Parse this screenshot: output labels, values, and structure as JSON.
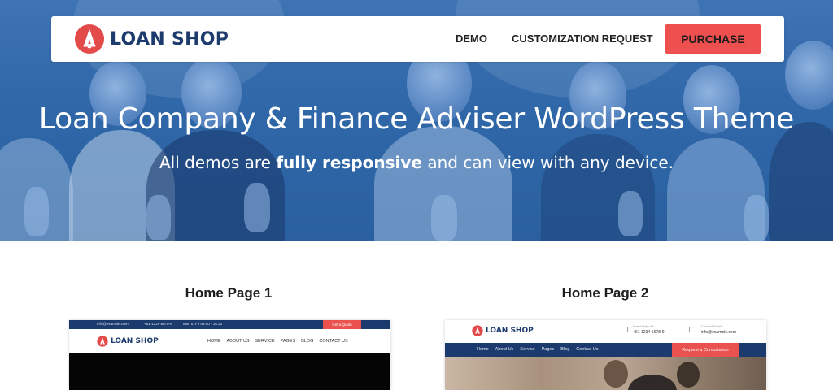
{
  "navbar": {
    "brand": "LOAN SHOP",
    "links": [
      "DEMO",
      "CUSTOMIZATION REQUEST"
    ],
    "purchase_label": "PURCHASE"
  },
  "hero": {
    "title": "Loan Company & Finance Adviser WordPress Theme",
    "subtitle_before": "All demos are ",
    "subtitle_bold": "fully responsive",
    "subtitle_after": " and can view with any device."
  },
  "demos": [
    {
      "title": "Home Page 1",
      "preview": {
        "topbar": [
          "info@example.com",
          "+61-1234-5678-9",
          "Mon to Fri 08:00 - 16:30"
        ],
        "quote_label": "Get a Quote",
        "brand": "LOAN SHOP",
        "menu": [
          "HOME",
          "ABOUT US",
          "SERVICE",
          "PAGES",
          "BLOG",
          "CONTACT US"
        ]
      }
    },
    {
      "title": "Home Page 2",
      "preview": {
        "brand": "LOAN SHOP",
        "contacts": [
          {
            "label": "Need help call :",
            "value": "+61-1234-5678-9",
            "icon": "phone-icon"
          },
          {
            "label": "Contact Email :",
            "value": "info@example.com",
            "icon": "mail-icon"
          }
        ],
        "menu": [
          "Home",
          "About Us",
          "Service",
          "Pages",
          "Blog",
          "Contact Us"
        ],
        "cta_label": "Request a Consultation"
      }
    }
  ],
  "colors": {
    "hero_blue": "#2f67a9",
    "accent_red": "#ee4f4f",
    "brand_navy": "#1e3b6d"
  }
}
